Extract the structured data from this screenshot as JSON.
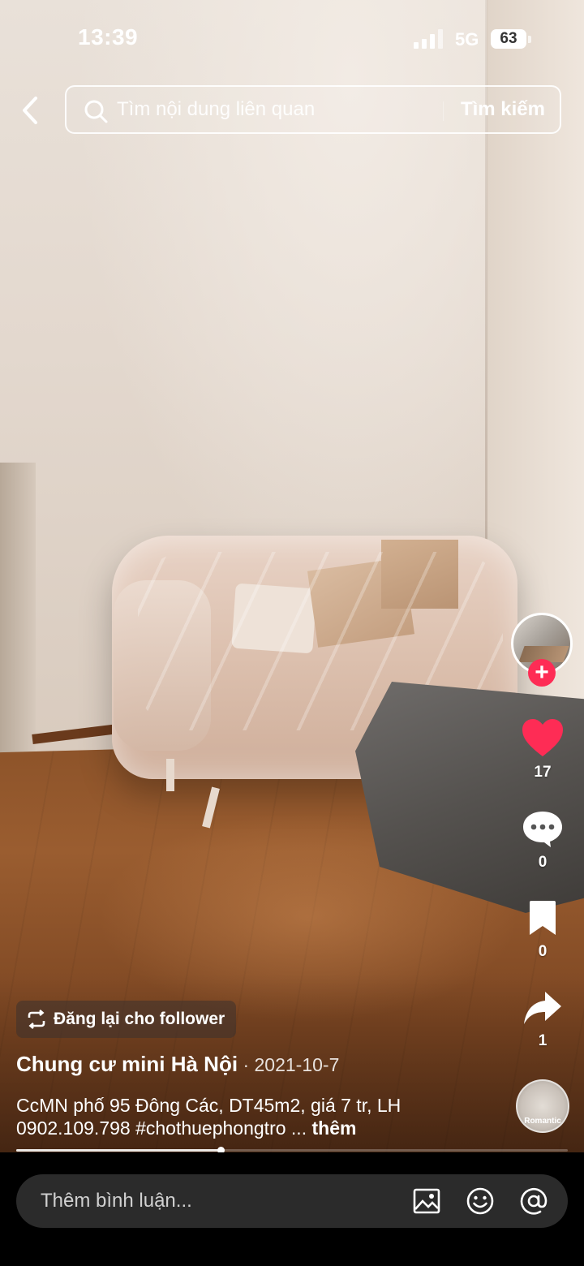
{
  "status_bar": {
    "time": "13:39",
    "network": "5G",
    "battery": "63"
  },
  "search": {
    "placeholder": "Tìm nội dung liên quan",
    "action_label": "Tìm kiếm"
  },
  "actions": {
    "likes": "17",
    "comments": "0",
    "saves": "0",
    "shares": "1",
    "music_label": "Romantic"
  },
  "post": {
    "repost_label": "Đăng lại cho follower",
    "author": "Chung cư mini Hà Nội",
    "date_separator": " · ",
    "date": "2021-10-7",
    "caption": "CcMN phố 95 Đông Các, DT45m2, giá 7 tr, LH 0902.109.798 #chothuephongtro ...",
    "more_label": "thêm",
    "progress": 0.37
  },
  "comment_bar": {
    "placeholder": "Thêm bình luận..."
  },
  "colors": {
    "accent": "#fe2c55",
    "background": "#000000"
  },
  "icons": [
    "back-icon",
    "search-icon",
    "plus-icon",
    "heart-icon",
    "comment-icon",
    "bookmark-icon",
    "share-icon",
    "repost-icon",
    "image-icon",
    "emoji-icon",
    "mention-icon",
    "music-disc-icon"
  ]
}
